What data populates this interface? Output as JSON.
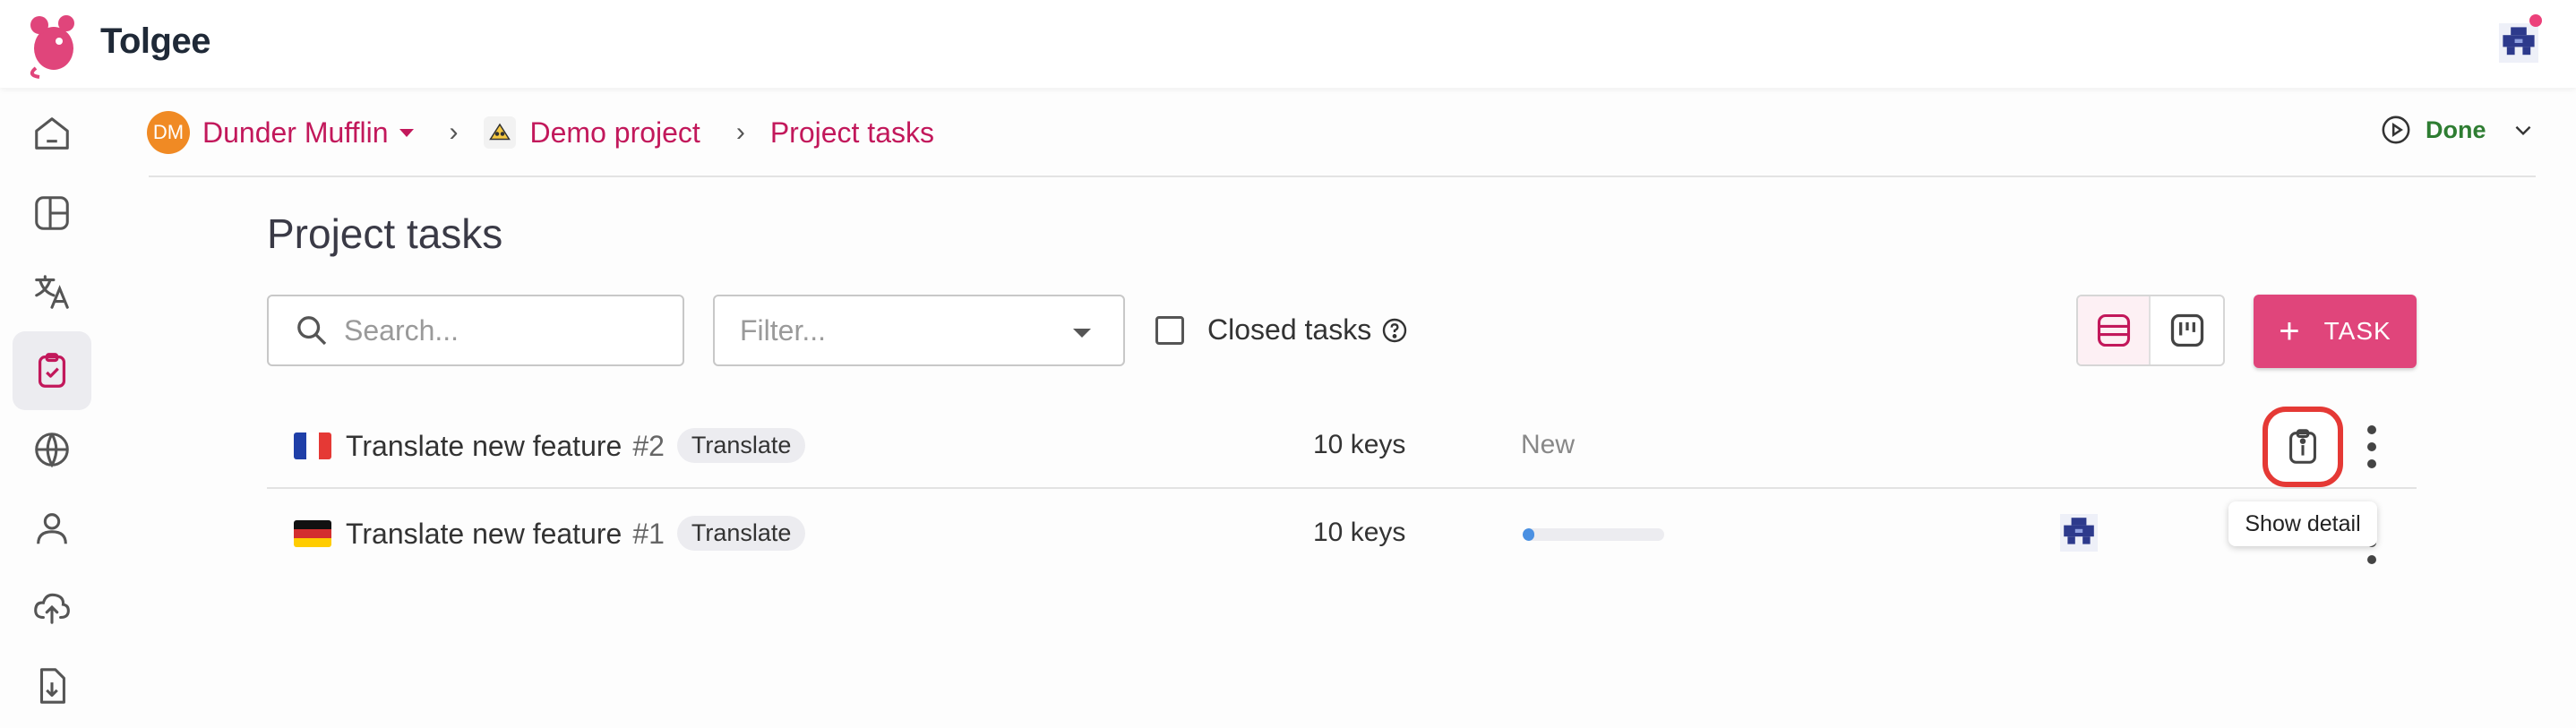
{
  "app": {
    "brand": "Tolgee",
    "accent_color": "#e0457b"
  },
  "sidebar": {
    "items": [
      {
        "name": "home",
        "icon": "home-icon",
        "active": false
      },
      {
        "name": "dashboard",
        "icon": "layout-icon",
        "active": false
      },
      {
        "name": "translations",
        "icon": "translate-icon",
        "active": false
      },
      {
        "name": "tasks",
        "icon": "clipboard-check-icon",
        "active": true
      },
      {
        "name": "languages",
        "icon": "globe-icon",
        "active": false
      },
      {
        "name": "members",
        "icon": "user-icon",
        "active": false
      },
      {
        "name": "import",
        "icon": "cloud-upload-icon",
        "active": false
      },
      {
        "name": "export",
        "icon": "file-download-icon",
        "active": false
      }
    ]
  },
  "breadcrumb": {
    "org_initials": "DM",
    "org_name": "Dunder Mufflin",
    "project_name": "Demo project",
    "current": "Project tasks"
  },
  "status": {
    "label": "Done",
    "color": "#2e7d32"
  },
  "page": {
    "title": "Project tasks"
  },
  "controls": {
    "search_placeholder": "Search...",
    "filter_placeholder": "Filter...",
    "closed_tasks_label": "Closed tasks",
    "closed_tasks_checked": false,
    "add_task_label": "TASK"
  },
  "tasks": [
    {
      "language": "French",
      "flag_colors": [
        "#1f3fa8",
        "#ffffff",
        "#e53935"
      ],
      "name": "Translate new feature",
      "number": "#2",
      "type": "Translate",
      "keys": "10 keys",
      "state": "New"
    },
    {
      "language": "German",
      "flag_colors": [
        "#111111",
        "#d32f2f",
        "#ffcc00"
      ],
      "name": "Translate new feature",
      "number": "#1",
      "type": "Translate",
      "keys": "10 keys",
      "progress": 0.08
    }
  ],
  "tooltip": {
    "text": "Show detail"
  }
}
